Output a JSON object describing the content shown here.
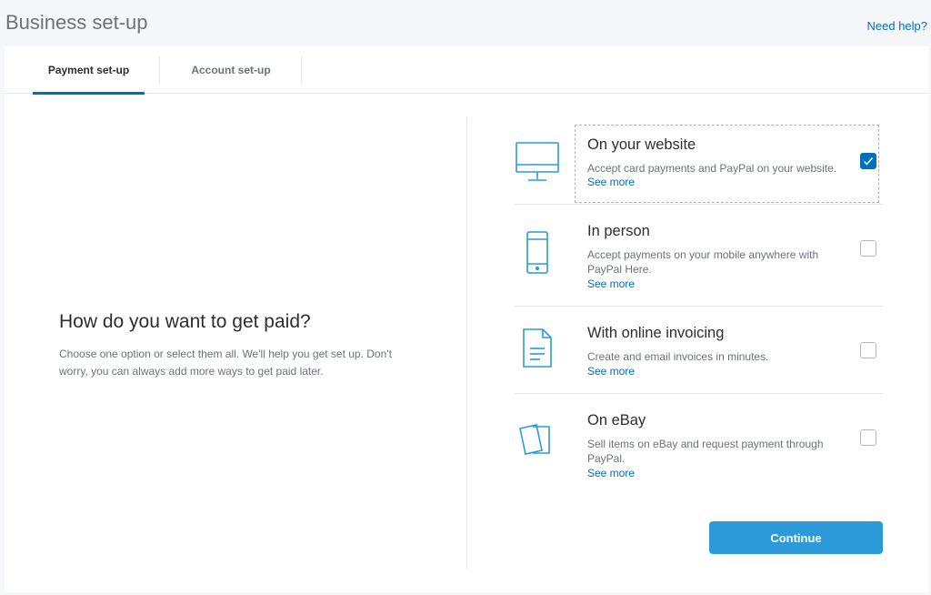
{
  "header": {
    "title": "Business set-up",
    "help_link": "Need help?"
  },
  "tabs": [
    {
      "label": "Payment set-up",
      "active": true
    },
    {
      "label": "Account set-up",
      "active": false
    }
  ],
  "intro": {
    "heading": "How do you want to get paid?",
    "text": "Choose one option or select them all. We'll help you get set up. Don't worry, you can always add more ways to get paid later."
  },
  "options": [
    {
      "icon": "monitor-icon",
      "title": "On your website",
      "description": "Accept card payments and PayPal on your website.",
      "link": "See more",
      "checked": true
    },
    {
      "icon": "mobile-phone-icon",
      "title": "In person",
      "description": "Accept payments on your mobile anywhere with PayPal Here.",
      "link": "See more",
      "checked": false
    },
    {
      "icon": "invoice-document-icon",
      "title": "With online invoicing",
      "description": "Create and email invoices in minutes.",
      "link": "See more",
      "checked": false
    },
    {
      "icon": "cards-icon",
      "title": "On eBay",
      "description": "Sell items on eBay and request payment through PayPal.",
      "link": "See more",
      "checked": false
    }
  ],
  "actions": {
    "continue_label": "Continue"
  },
  "colors": {
    "accent": "#0070ba",
    "button": "#2c9ad8",
    "icon": "#2c9ad8"
  }
}
